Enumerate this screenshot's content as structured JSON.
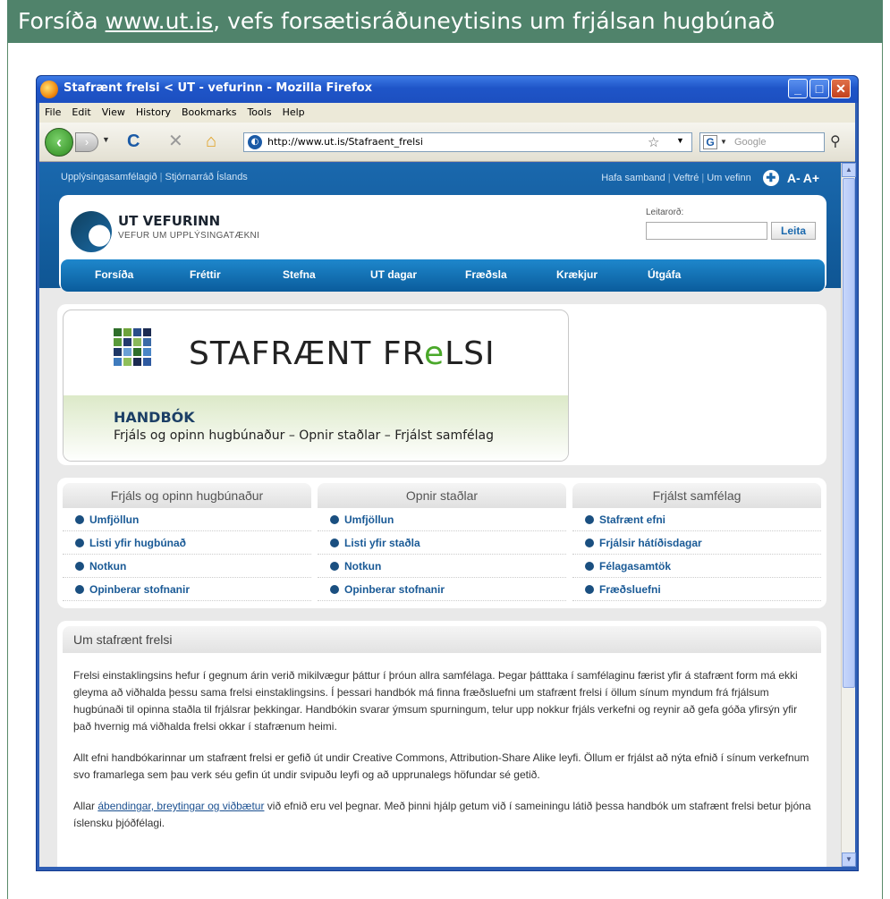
{
  "slide": {
    "title_prefix": "Forsíða ",
    "title_url": "www.ut.is",
    "title_suffix": ", vefs forsætisráðuneytisins um frjálsan hugbúnað"
  },
  "browser": {
    "window_title": "Stafrænt frelsi < UT - vefurinn - Mozilla Firefox",
    "menu": [
      "File",
      "Edit",
      "View",
      "History",
      "Bookmarks",
      "Tools",
      "Help"
    ],
    "url": "http://www.ut.is/Stafraent_frelsi",
    "search_placeholder": "Google"
  },
  "site": {
    "topbar_left": [
      "Upplýsingasamfélagið",
      "Stjórnarráð Íslands"
    ],
    "topbar_right": [
      "Hafa samband",
      "Veftré",
      "Um vefinn"
    ],
    "font_smaller": "A-",
    "font_larger": "A+",
    "logo_title": "UT VEFURINN",
    "logo_subtitle": "VEFUR UM UPPLÝSINGATÆKNI",
    "search_label": "Leitarorð:",
    "search_button": "Leita",
    "nav": [
      "Forsíða",
      "Fréttir",
      "Stefna",
      "UT dagar",
      "Fræðsla",
      "Krækjur",
      "Útgáfa"
    ]
  },
  "banner": {
    "title_part1": "STAFRÆNT FR",
    "title_e": "e",
    "title_part2": "LSI",
    "handbook_title": "HANDBÓK",
    "handbook_subtitle": "Frjáls og opinn hugbúnaður – Opnir staðlar – Frjálst samfélag"
  },
  "columns": [
    {
      "heading": "Frjáls og opinn hugbúnaður",
      "items": [
        "Umfjöllun",
        "Listi yfir hugbúnað",
        "Notkun",
        "Opinberar stofnanir"
      ]
    },
    {
      "heading": "Opnir staðlar",
      "items": [
        "Umfjöllun",
        "Listi yfir staðla",
        "Notkun",
        "Opinberar stofnanir"
      ]
    },
    {
      "heading": "Frjálst samfélag",
      "items": [
        "Stafrænt efni",
        "Frjálsir hátíðisdagar",
        "Félagasamtök",
        "Fræðsluefni"
      ]
    }
  ],
  "about": {
    "heading": "Um stafrænt frelsi",
    "p1": "Frelsi einstaklingsins hefur í gegnum árin verið mikilvægur þáttur í þróun allra samfélaga. Þegar þátttaka í samfélaginu færist yfir á stafrænt form má ekki gleyma að viðhalda þessu sama frelsi einstaklingsins. Í þessari handbók má finna fræðsluefni um stafrænt frelsi í öllum sínum myndum frá frjálsum hugbúnaði til opinna staðla til frjálsrar þekkingar. Handbókin svarar ýmsum spurningum, telur upp nokkur frjáls verkefni og reynir að gefa góða yfirsýn yfir það hvernig má viðhalda frelsi okkar í stafrænum heimi.",
    "p2": "Allt efni handbókarinnar um stafrænt frelsi er gefið út undir Creative Commons, Attribution-Share Alike leyfi. Öllum er frjálst að nýta efnið í sínum verkefnum svo framarlega sem þau verk séu gefin út undir svipuðu leyfi og að upprunalegs höfundar sé getið.",
    "p3_pre": "Allar ",
    "p3_link": "ábendingar, breytingar og viðbætur",
    "p3_post": " við efnið eru vel þegnar. Með þinni hjálp getum við í sameiningu látið þessa handbók um stafrænt frelsi betur þjóna íslensku þjóðfélagi."
  }
}
